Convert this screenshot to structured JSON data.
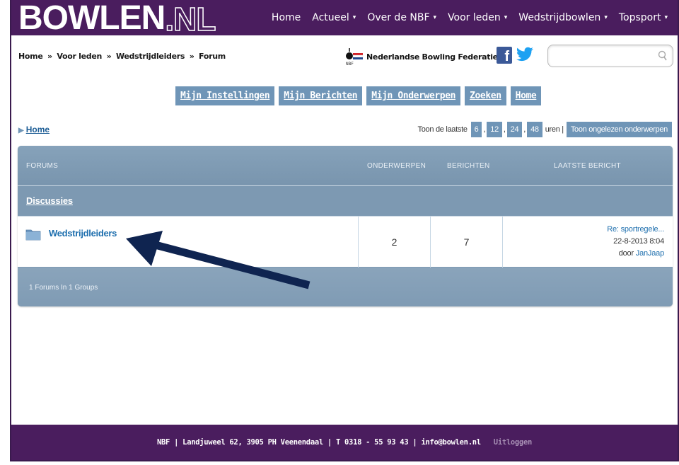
{
  "header": {
    "logo_main": "BOWLEN",
    "logo_ext": ".NL",
    "nav": [
      {
        "label": "Home",
        "dropdown": false
      },
      {
        "label": "Actueel",
        "dropdown": true
      },
      {
        "label": "Over de NBF",
        "dropdown": true
      },
      {
        "label": "Voor leden",
        "dropdown": true
      },
      {
        "label": "Wedstrijdbowlen",
        "dropdown": true
      },
      {
        "label": "Topsport",
        "dropdown": true
      }
    ],
    "dropdown_glyph": "▾"
  },
  "breadcrumb": {
    "items": [
      "Home",
      "Voor leden",
      "Wedstrijdleiders",
      "Forum"
    ],
    "separator": "»"
  },
  "nbf": {
    "name": "Nederlandse Bowling Federatie",
    "logo_sub": "NBF"
  },
  "social": {
    "facebook_glyph": "f"
  },
  "search": {
    "value": "",
    "placeholder": ""
  },
  "forum_buttons": [
    "Mijn Instellingen",
    "Mijn Berichten",
    "Mijn Onderwerpen",
    "Zoeken",
    "Home"
  ],
  "home_link": {
    "label": "Home"
  },
  "show_last": {
    "prefix": "Toon de laatste",
    "hours": [
      "6",
      "12",
      "24",
      "48"
    ],
    "suffix": "uren |",
    "unread_label": "Toon ongelezen onderwerpen"
  },
  "table": {
    "headers": {
      "forums": "FORUMS",
      "topics": "ONDERWERPEN",
      "posts": "BERICHTEN",
      "last_post": "LAATSTE BERICHT"
    },
    "group_name": "Discussies",
    "forums": [
      {
        "name": "Wedstrijdleiders",
        "topics": "2",
        "posts": "7",
        "last_post_title": "Re: sportregele...",
        "last_post_date": "22-8-2013 8:04",
        "last_post_by": "door",
        "last_post_author": "JanJaap"
      }
    ],
    "footer_text": "1 Forums In 1 Groups"
  },
  "footer": {
    "org": "NBF",
    "address": "Landjuweel 62, 3905 PH Veenendaal",
    "phone": "T 0318 - 55 93 43",
    "email": "info@bowlen.nl",
    "divider": "|",
    "logout": "Uitloggen"
  },
  "colors": {
    "brand_purple": "#4a1d5e",
    "button_blue": "#6f95b7",
    "table_blue": "#7f9bb4",
    "link_blue": "#1e6fae",
    "arrow": "#0f2450"
  }
}
